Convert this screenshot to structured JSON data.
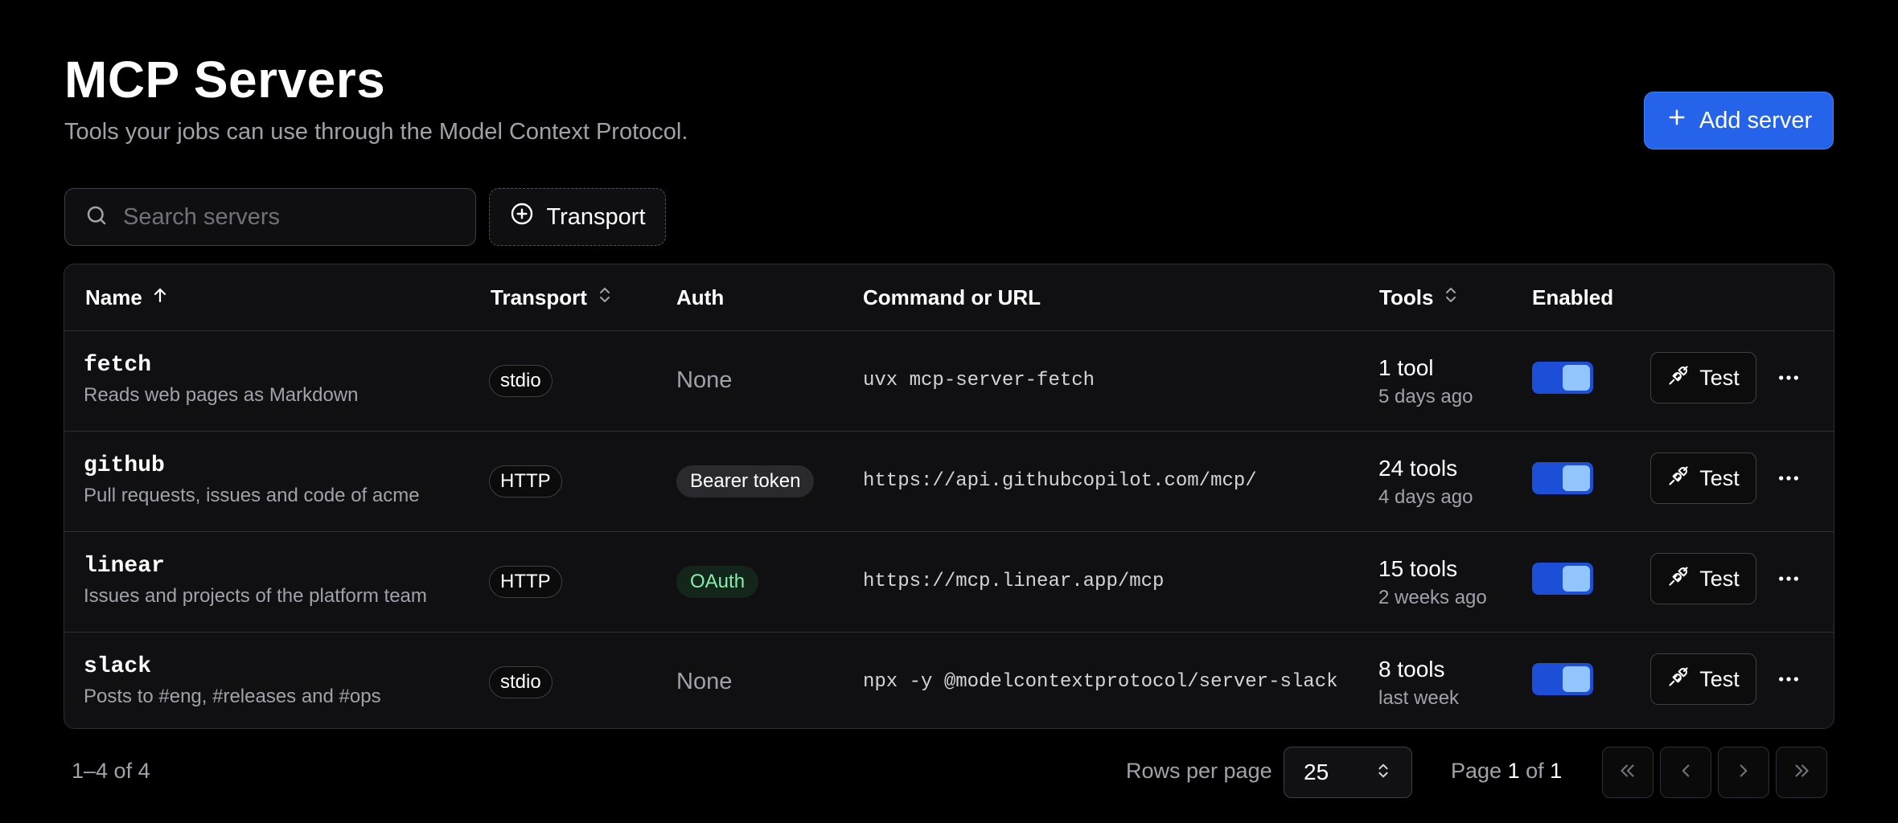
{
  "header": {
    "title": "MCP Servers",
    "subtitle": "Tools your jobs can use through the Model Context Protocol.",
    "add_button": "Add server"
  },
  "toolbar": {
    "search_placeholder": "Search servers",
    "transport_filter": "Transport"
  },
  "table": {
    "columns": {
      "name": "Name",
      "transport": "Transport",
      "auth": "Auth",
      "command": "Command or URL",
      "tools": "Tools",
      "enabled": "Enabled"
    },
    "rows": [
      {
        "name": "fetch",
        "description": "Reads web pages as Markdown",
        "transport": "stdio",
        "auth": "None",
        "command": "uvx mcp-server-fetch",
        "tools": "1 tool",
        "updated": "5 days ago",
        "enabled": true,
        "test_label": "Test"
      },
      {
        "name": "github",
        "description": "Pull requests, issues and code of acme",
        "transport": "HTTP",
        "auth": "Bearer token",
        "command": "https://api.githubcopilot.com/mcp/",
        "tools": "24 tools",
        "updated": "4 days ago",
        "enabled": true,
        "test_label": "Test"
      },
      {
        "name": "linear",
        "description": "Issues and projects of the platform team",
        "transport": "HTTP",
        "auth": "OAuth",
        "command": "https://mcp.linear.app/mcp",
        "tools": "15 tools",
        "updated": "2 weeks ago",
        "enabled": true,
        "test_label": "Test"
      },
      {
        "name": "slack",
        "description": "Posts to #eng, #releases and #ops",
        "transport": "stdio",
        "auth": "None",
        "command": "npx -y @modelcontextprotocol/server-slack",
        "tools": "8 tools",
        "updated": "last week",
        "enabled": true,
        "test_label": "Test"
      }
    ]
  },
  "footer": {
    "count": "1–4 of 4",
    "rows_per_page_label": "Rows per page",
    "rows_per_page_value": "25",
    "page_label": "Page",
    "page_current": "1",
    "page_of": "of",
    "page_total": "1"
  },
  "colors": {
    "accent": "#2563eb",
    "oauth_text": "#86efac",
    "background": "#000000"
  }
}
